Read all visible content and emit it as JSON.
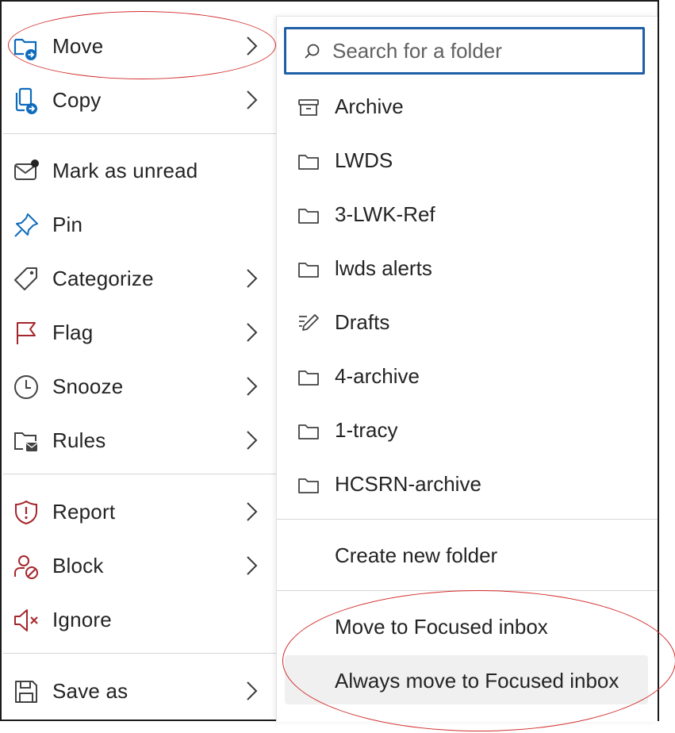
{
  "menu": {
    "items": [
      {
        "label": "Move",
        "icon": "folder-move-icon",
        "chevron": true
      },
      {
        "label": "Copy",
        "icon": "copy-to-icon",
        "chevron": true
      },
      {
        "label": "Mark as unread",
        "icon": "mail-unread-icon",
        "chevron": false
      },
      {
        "label": "Pin",
        "icon": "pin-icon",
        "chevron": false
      },
      {
        "label": "Categorize",
        "icon": "tag-icon",
        "chevron": true
      },
      {
        "label": "Flag",
        "icon": "flag-icon",
        "chevron": true
      },
      {
        "label": "Snooze",
        "icon": "clock-icon",
        "chevron": true
      },
      {
        "label": "Rules",
        "icon": "folder-mail-icon",
        "chevron": true
      },
      {
        "label": "Report",
        "icon": "shield-alert-icon",
        "chevron": true
      },
      {
        "label": "Block",
        "icon": "person-prohibited-icon",
        "chevron": true
      },
      {
        "label": "Ignore",
        "icon": "speaker-mute-icon",
        "chevron": false
      },
      {
        "label": "Save as",
        "icon": "save-icon",
        "chevron": true
      }
    ]
  },
  "submenu": {
    "search_placeholder": "Search for a folder",
    "folders": [
      {
        "label": "Archive",
        "icon": "archive-icon"
      },
      {
        "label": "LWDS",
        "icon": "folder-icon"
      },
      {
        "label": "3-LWK-Ref",
        "icon": "folder-icon"
      },
      {
        "label": "lwds alerts",
        "icon": "folder-icon"
      },
      {
        "label": "Drafts",
        "icon": "drafts-icon"
      },
      {
        "label": "4-archive",
        "icon": "folder-icon"
      },
      {
        "label": "1-tracy",
        "icon": "folder-icon"
      },
      {
        "label": "HCSRN-archive",
        "icon": "folder-icon"
      }
    ],
    "create_new_folder": "Create new folder",
    "move_to_focused": "Move to Focused inbox",
    "always_move_to_focused": "Always move to Focused inbox"
  },
  "colors": {
    "accent": "#0f6cbd",
    "danger_icon": "#a4262c",
    "annotation": "#d22b2b",
    "search_border": "#1f5fa6"
  }
}
